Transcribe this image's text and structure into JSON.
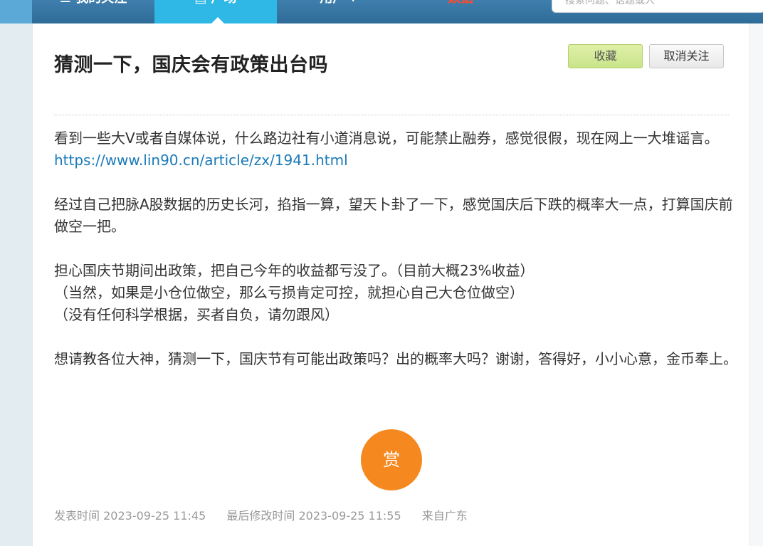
{
  "nav": {
    "mine": "我的关注",
    "square": "广场",
    "user": "用户",
    "data": "数据"
  },
  "search": {
    "placeholder": "搜索问题、话题或人"
  },
  "post": {
    "title": "猜测一下，国庆会有政策出台吗",
    "favorite_label": "收藏",
    "unfollow_label": "取消关注",
    "p1": "看到一些大V或者自媒体说，什么路边社有小道消息说，可能禁止融券，感觉很假，现在网上一大堆谣言。",
    "link": "https://www.lin90.cn/article/zx/1941.html",
    "p2": "经过自己把脉A股数据的历史长河，掐指一算，望天卜卦了一下，感觉国庆后下跌的概率大一点，打算国庆前做空一把。",
    "p3_line1": "担心国庆节期间出政策，把自己今年的收益都亏没了。（目前大概23%收益）",
    "p3_line2": "（当然，如果是小仓位做空，那么亏损肯定可控，就担心自己大仓位做空）",
    "p3_line3": "（没有任何科学根据，买者自负，请勿跟风）",
    "p4": "想请教各位大神，猜测一下，国庆节有可能出政策吗？出的概率大吗？谢谢，答得好，小小心意，金币奉上。",
    "reward_label": "赏",
    "published": "发表时间 2023-09-25 11:45",
    "modified": "最后修改时间 2023-09-25 11:55",
    "location": "来自广东"
  }
}
